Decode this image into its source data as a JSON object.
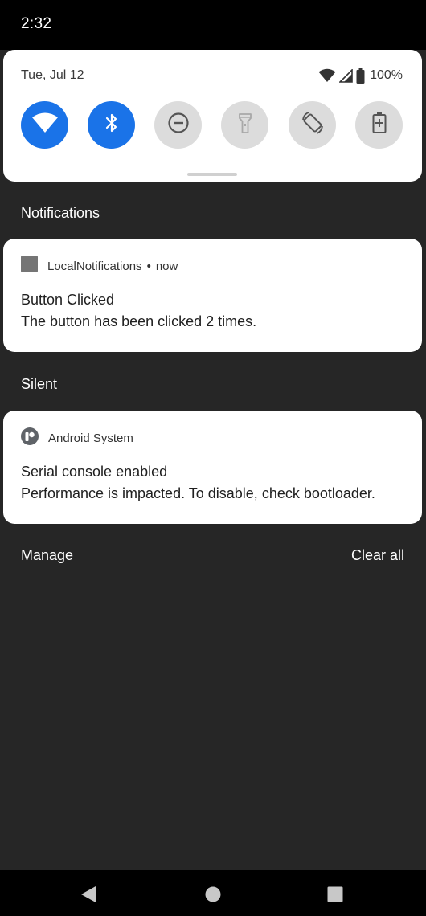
{
  "status_bar": {
    "time": "2:32"
  },
  "quick_settings": {
    "date": "Tue, Jul 12",
    "battery_percent": "100%",
    "tiles": [
      {
        "icon": "wifi-icon",
        "state": "on"
      },
      {
        "icon": "bluetooth-icon",
        "state": "on"
      },
      {
        "icon": "do-not-disturb-icon",
        "state": "off"
      },
      {
        "icon": "flashlight-icon",
        "state": "off"
      },
      {
        "icon": "auto-rotate-icon",
        "state": "off"
      },
      {
        "icon": "battery-saver-icon",
        "state": "off"
      }
    ]
  },
  "sections": {
    "notifications": "Notifications",
    "silent": "Silent"
  },
  "notifications": [
    {
      "app": "LocalNotifications",
      "separator": "•",
      "time": "now",
      "title": "Button Clicked",
      "body": "The button has been clicked 2 times."
    },
    {
      "app": "Android System",
      "title": "Serial console enabled",
      "body": "Performance is impacted. To disable, check bootloader."
    }
  ],
  "footer": {
    "manage": "Manage",
    "clear_all": "Clear all"
  },
  "colors": {
    "accent": "#1a73e8",
    "background": "#262626"
  }
}
